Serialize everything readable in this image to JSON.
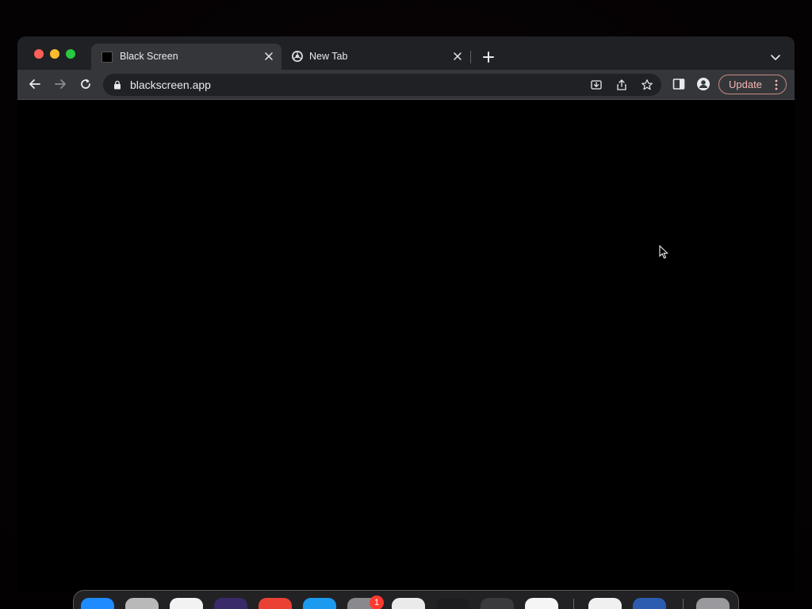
{
  "browser": {
    "tabs": [
      {
        "title": "Black Screen",
        "active": true,
        "favicon": "black-square-icon"
      },
      {
        "title": "New Tab",
        "active": false,
        "favicon": "chrome-icon"
      }
    ],
    "address_bar": {
      "url": "blackscreen.app"
    },
    "update_button": {
      "label": "Update"
    }
  },
  "dock": {
    "apps": [
      {
        "name": "finder-icon",
        "color": "#1e8cff"
      },
      {
        "name": "launchpad-icon",
        "color": "#b9b9b9"
      },
      {
        "name": "safari-icon",
        "color": "#f2f2f2"
      },
      {
        "name": "photo-app-icon",
        "color": "#3a2a6a"
      },
      {
        "name": "chrome-icon",
        "color": "#e94235"
      },
      {
        "name": "xcode-icon",
        "color": "#1a9bf0"
      },
      {
        "name": "system-preferences-icon",
        "color": "#8a8a8e"
      },
      {
        "name": "textedit-icon",
        "color": "#eaeaea"
      },
      {
        "name": "terminal-icon",
        "color": "#1d1d1f"
      },
      {
        "name": "script-editor-icon",
        "color": "#3a3a3c"
      },
      {
        "name": "vscode-icon",
        "color": "#f5f5f5"
      },
      {
        "name": "visual-studio-icon",
        "color": "#f0f0f0"
      },
      {
        "name": "python-app-icon",
        "color": "#2b5cb0"
      },
      {
        "name": "trash-icon",
        "color": "#9a9a9e"
      }
    ],
    "badge_count": "1"
  }
}
